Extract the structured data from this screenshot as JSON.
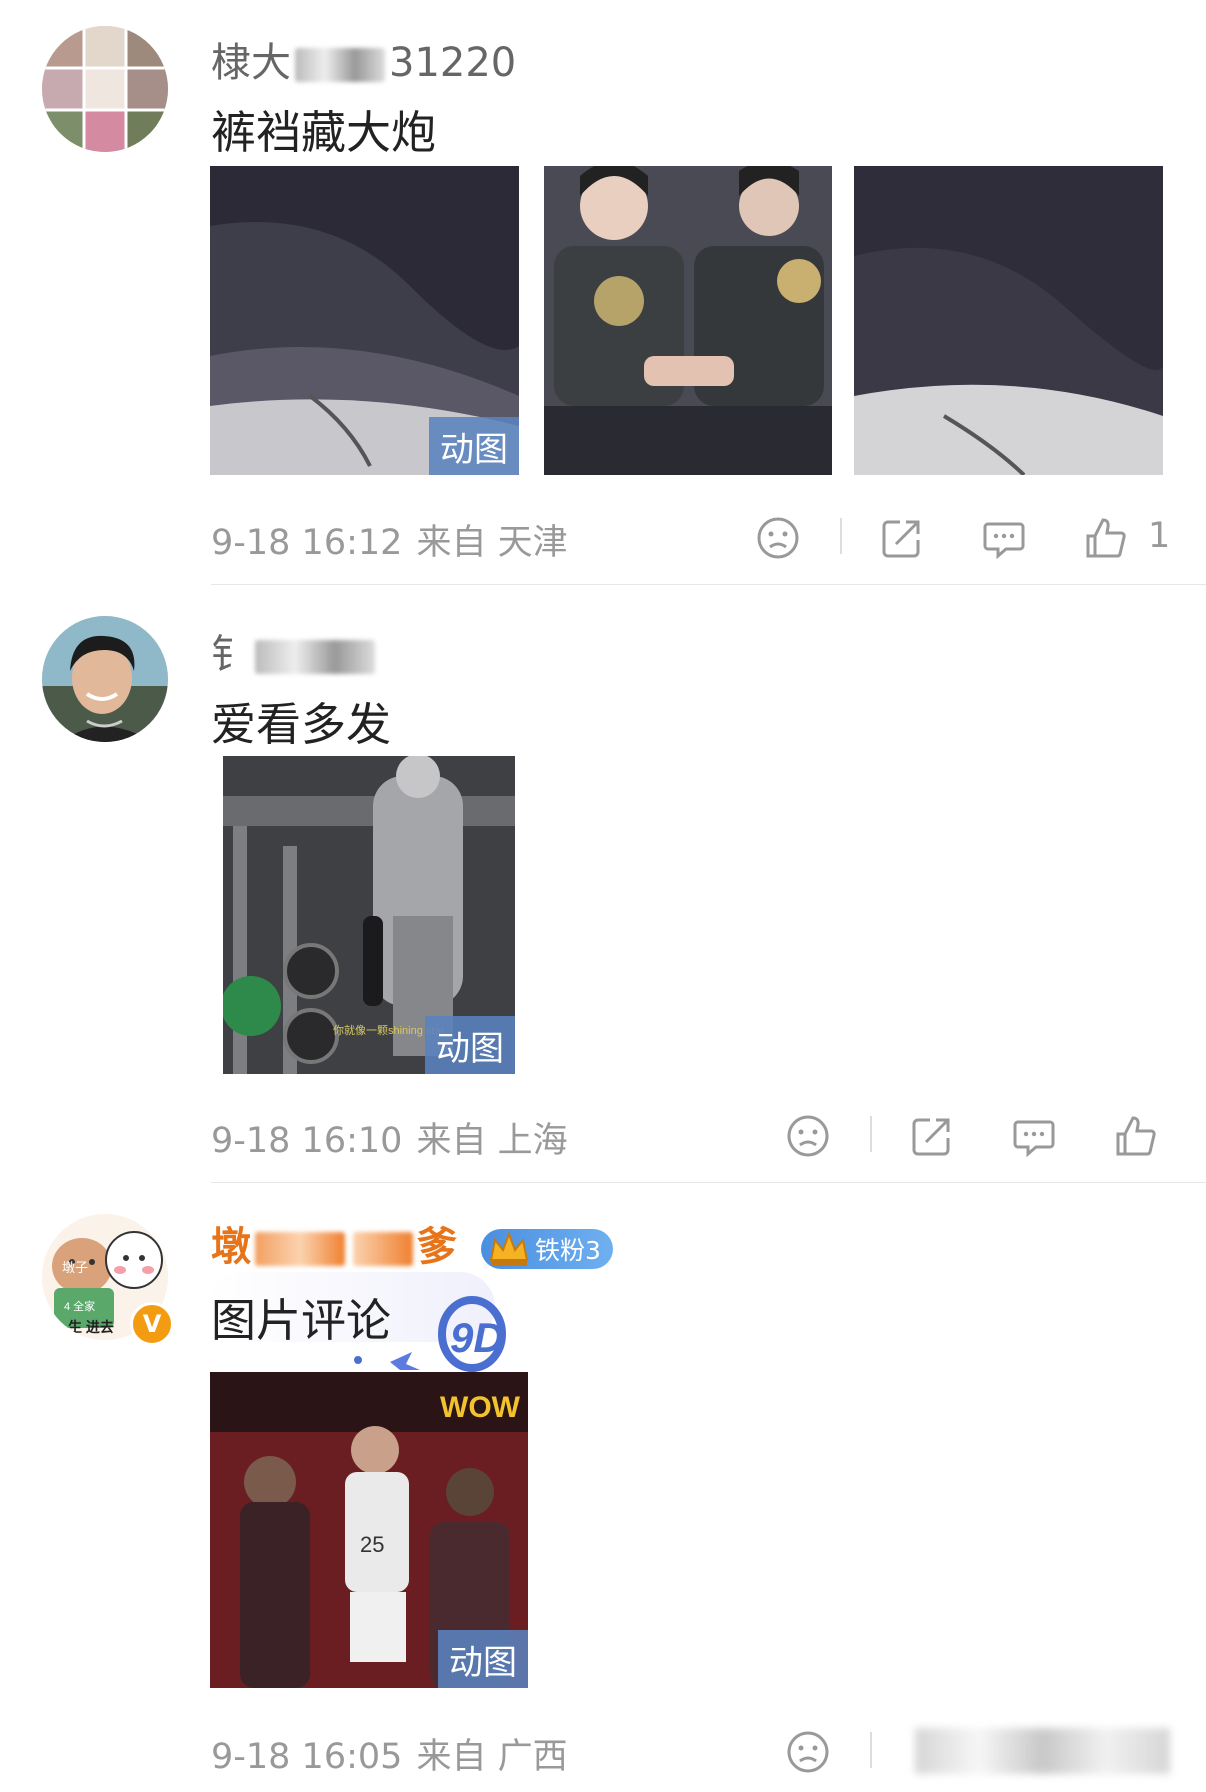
{
  "comments": [
    {
      "username_visible": "棣大",
      "username_suffix": "31220",
      "text": "裤裆藏大炮",
      "images": [
        {
          "gif": true,
          "badge": "动图"
        },
        {
          "gif": false
        },
        {
          "gif": false
        }
      ],
      "time": "9-18 16:12",
      "source": "来自 天津",
      "like_count": "1"
    },
    {
      "username_visible": "钅",
      "username_suffix": "",
      "text": "爱看多发",
      "images": [
        {
          "gif": true,
          "badge": "动图"
        }
      ],
      "time": "9-18 16:10",
      "source": "来自 上海",
      "like_count": ""
    },
    {
      "username_visible": "墩",
      "username_suffix": "爹",
      "fan_badge": "铁粉3",
      "verified": "V",
      "avatar_text": "墩子 4 全家 生 进去",
      "text": "图片评论",
      "images": [
        {
          "gif": true,
          "badge": "动图"
        }
      ],
      "time": "9-18 16:05",
      "source": "来自 广西",
      "like_count": ""
    }
  ],
  "icons": [
    "sad-face-icon",
    "share-icon",
    "comment-icon",
    "thumbs-up-icon"
  ],
  "colors": {
    "accent_vip": "#e8741a",
    "gif_badge": "#5a82be",
    "meta": "#999999",
    "fan_badge": "#4a8fe0"
  }
}
